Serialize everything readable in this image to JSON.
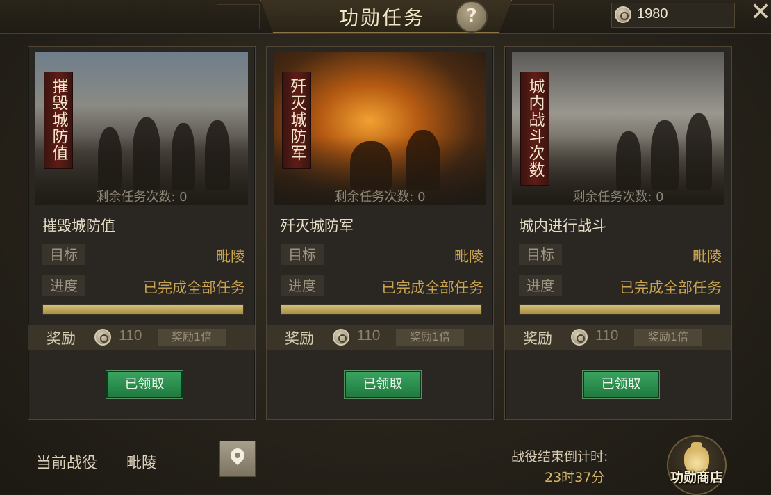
{
  "header": {
    "title": "功勋任务",
    "help_icon": "question-mark-icon",
    "help_label": "?",
    "currency": {
      "icon": "coin-icon",
      "value": "1980"
    },
    "close_icon": "close-icon",
    "close_label": "✕"
  },
  "cards": [
    {
      "banner": "摧毁城防值",
      "remaining": "剩余任务次数: 0",
      "name": "摧毁城防值",
      "target_label": "目标",
      "target_value": "毗陵",
      "progress_label": "进度",
      "progress_value": "已完成全部任务",
      "progress_fraction": 1.0,
      "reward_label": "奖励",
      "reward_amount": "110",
      "reward_multiplier": "奖励1倍",
      "button_label": "已领取"
    },
    {
      "banner": "歼灭城防军",
      "remaining": "剩余任务次数: 0",
      "name": "歼灭城防军",
      "target_label": "目标",
      "target_value": "毗陵",
      "progress_label": "进度",
      "progress_value": "已完成全部任务",
      "progress_fraction": 1.0,
      "reward_label": "奖励",
      "reward_amount": "110",
      "reward_multiplier": "奖励1倍",
      "button_label": "已领取"
    },
    {
      "banner": "城内战斗次数",
      "remaining": "剩余任务次数: 0",
      "name": "城内进行战斗",
      "target_label": "目标",
      "target_value": "毗陵",
      "progress_label": "进度",
      "progress_value": "已完成全部任务",
      "progress_fraction": 1.0,
      "reward_label": "奖励",
      "reward_amount": "110",
      "reward_multiplier": "奖励1倍",
      "button_label": "已领取"
    }
  ],
  "footer": {
    "campaign_label": "当前战役",
    "campaign_value": "毗陵",
    "location_icon": "map-pin-icon",
    "countdown_label": "战役结束倒计时:",
    "countdown_value": "23时37分",
    "shop_icon": "money-bag-icon",
    "shop_label": "功勋商店"
  },
  "colors": {
    "accent_gold": "#c9a553",
    "button_green": "#2a8e4d",
    "banner_red": "#5e1d16",
    "progress_fill": "#c7ad5e"
  }
}
